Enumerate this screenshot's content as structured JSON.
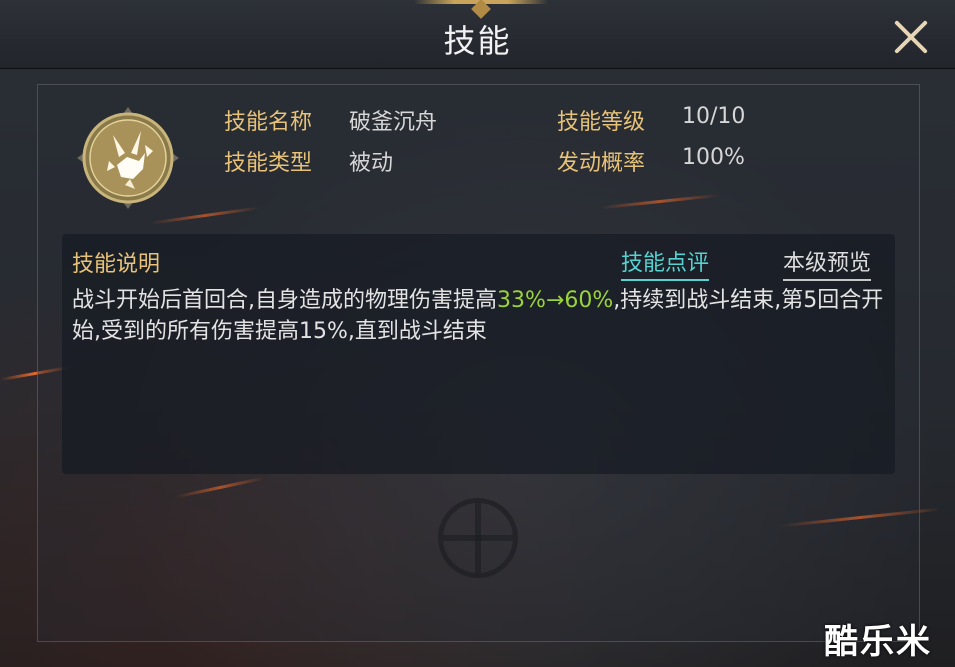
{
  "header": {
    "title": "技能",
    "close_icon": "close-icon"
  },
  "skill": {
    "icon": "shattered-blade-icon",
    "name_label": "技能名称",
    "name_value": "破釜沉舟",
    "type_label": "技能类型",
    "type_value": "被动",
    "level_label": "技能等级",
    "level_value": "10/10",
    "chance_label": "发动概率",
    "chance_value": "100%"
  },
  "description": {
    "title": "技能说明",
    "tab_review": "技能点评",
    "tab_preview": "本级预览",
    "text_part1": "战斗开始后首回合,自身造成的物理伤害提高",
    "highlight": "33%→60%",
    "text_part2": ",持续到战斗结束,第5回合开始,受到的所有伤害提高15%,直到战斗结束"
  },
  "watermark": "酷乐米",
  "colors": {
    "label_gold": "#e7c277",
    "highlight_green": "#9ad43a",
    "review_cyan": "#56d3d0"
  }
}
